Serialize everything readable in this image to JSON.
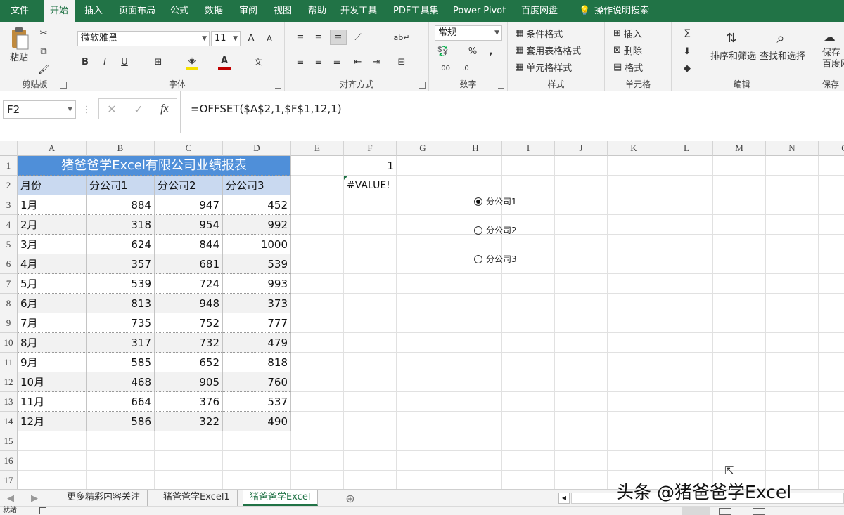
{
  "menu": {
    "tabs": [
      "文件",
      "开始",
      "插入",
      "页面布局",
      "公式",
      "数据",
      "审阅",
      "视图",
      "帮助",
      "开发工具",
      "PDF工具集",
      "Power Pivot",
      "百度网盘"
    ],
    "tell_me": "操作说明搜索"
  },
  "ribbon": {
    "clipboard": {
      "label": "剪贴板",
      "paste": "粘贴"
    },
    "font": {
      "label": "字体",
      "name": "微软雅黑",
      "size": "11",
      "bold": "B",
      "italic": "I",
      "underline": "U",
      "grow": "A",
      "shrink": "A",
      "phonetic": "文"
    },
    "alignment": {
      "label": "对齐方式"
    },
    "number": {
      "label": "数字",
      "format": "常规",
      "percent": "%",
      "comma": ",",
      "inc_decimal": ".00",
      "dec_decimal": ".0"
    },
    "styles": {
      "label": "样式",
      "conditional": "条件格式",
      "table": "套用表格格式",
      "cell": "单元格样式"
    },
    "cells": {
      "label": "单元格",
      "insert": "插入",
      "delete": "删除",
      "format": "格式"
    },
    "editing": {
      "label": "编辑",
      "sort": "排序和筛选",
      "find": "查找和选择"
    },
    "save": {
      "label": "保存",
      "line1": "保存",
      "line2": "百度网"
    }
  },
  "formula_bar": {
    "name_box": "F2",
    "formula": "=OFFSET($A$2,1,$F$1,12,1)",
    "fx": "fx"
  },
  "columns": [
    "A",
    "B",
    "C",
    "D",
    "E",
    "F",
    "G",
    "H",
    "I",
    "J",
    "K",
    "L",
    "M",
    "N",
    "O"
  ],
  "rows": [
    "1",
    "2",
    "3",
    "4",
    "5",
    "6",
    "7",
    "8",
    "9",
    "10",
    "11",
    "12",
    "13",
    "14",
    "15",
    "16",
    "17"
  ],
  "table": {
    "title": "猪爸爸学Excel有限公司业绩报表",
    "headers": [
      "月份",
      "分公司1",
      "分公司2",
      "分公司3"
    ],
    "data": [
      [
        "1月",
        "884",
        "947",
        "452"
      ],
      [
        "2月",
        "318",
        "954",
        "992"
      ],
      [
        "3月",
        "624",
        "844",
        "1000"
      ],
      [
        "4月",
        "357",
        "681",
        "539"
      ],
      [
        "5月",
        "539",
        "724",
        "993"
      ],
      [
        "6月",
        "813",
        "948",
        "373"
      ],
      [
        "7月",
        "735",
        "752",
        "777"
      ],
      [
        "8月",
        "317",
        "732",
        "479"
      ],
      [
        "9月",
        "585",
        "652",
        "818"
      ],
      [
        "10月",
        "468",
        "905",
        "760"
      ],
      [
        "11月",
        "664",
        "376",
        "537"
      ],
      [
        "12月",
        "586",
        "322",
        "490"
      ]
    ]
  },
  "cells": {
    "F1": "1",
    "F2": "#VALUE!"
  },
  "radios": [
    {
      "label": "分公司1",
      "checked": true
    },
    {
      "label": "分公司2",
      "checked": false
    },
    {
      "label": "分公司3",
      "checked": false
    }
  ],
  "sheets": [
    {
      "name": "更多精彩内容关注",
      "active": false
    },
    {
      "name": "猪爸爸学Excel1",
      "active": false
    },
    {
      "name": "猪爸爸学Excel",
      "active": true
    }
  ],
  "watermark": "头条 @猪爸爸学Excel",
  "status": {
    "ready": "就绪"
  },
  "colors": {
    "accent": "#217346",
    "title_fill": "#4f8fd9",
    "header_fill": "#c9d9f0"
  }
}
